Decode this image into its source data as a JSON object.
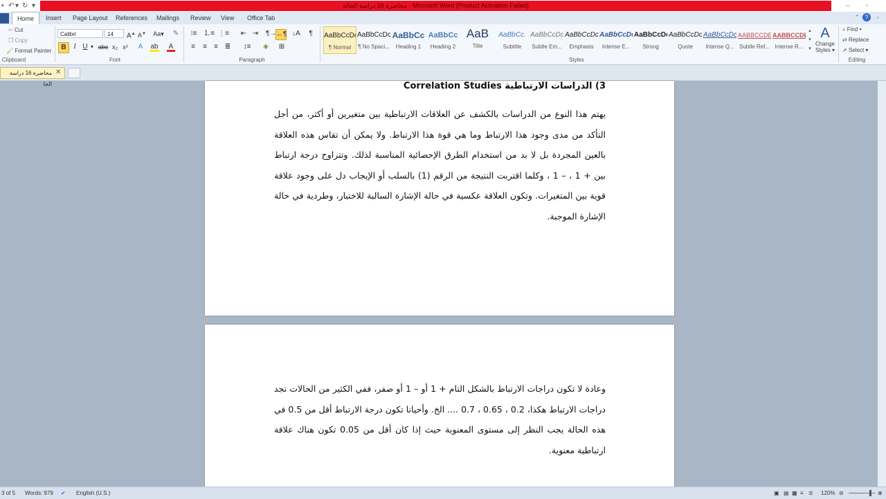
{
  "window": {
    "title": "محاضرة 16 دراسة الحالة  -  Microsoft Word (Product Activation Failed)",
    "controls": [
      "minimize",
      "restore",
      "close"
    ]
  },
  "ribbon_tabs": [
    {
      "label": "Home",
      "active": true
    },
    {
      "label": "Insert",
      "active": false
    },
    {
      "label": "Page Layout",
      "active": false
    },
    {
      "label": "References",
      "active": false
    },
    {
      "label": "Mailings",
      "active": false
    },
    {
      "label": "Review",
      "active": false
    },
    {
      "label": "View",
      "active": false
    },
    {
      "label": "Office Tab",
      "active": false
    }
  ],
  "clipboard": {
    "cut": "Cut",
    "copy": "Copy",
    "format_painter": "Format Painter",
    "label": "Clipboard"
  },
  "font": {
    "name": "Calibri",
    "size": "14",
    "label": "Font",
    "bold": "B",
    "italic": "I",
    "underline": "U",
    "strike": "abc"
  },
  "paragraph": {
    "label": "Paragraph"
  },
  "styles": {
    "label": "Styles",
    "items": [
      {
        "sample": "AaBbCcDc",
        "name": "¶ Normal"
      },
      {
        "sample": "AaBbCcDc",
        "name": "¶ No Spaci..."
      },
      {
        "sample": "AaBbCc",
        "name": "Heading 1"
      },
      {
        "sample": "AaBbCc",
        "name": "Heading 2"
      },
      {
        "sample": "AaB",
        "name": "Title"
      },
      {
        "sample": "AaBbCc.",
        "name": "Subtitle"
      },
      {
        "sample": "AaBbCcDc",
        "name": "Subtle Em..."
      },
      {
        "sample": "AaBbCcDc",
        "name": "Emphasis"
      },
      {
        "sample": "AaBbCcDc",
        "name": "Intense E..."
      },
      {
        "sample": "AaBbCcDc",
        "name": "Strong"
      },
      {
        "sample": "AaBbCcDc",
        "name": "Quote"
      },
      {
        "sample": "AaBbCcDc",
        "name": "Intense Q..."
      },
      {
        "sample": "AABBCCDE",
        "name": "Subtle Ref..."
      },
      {
        "sample": "AABBCCDE",
        "name": "Intense R..."
      }
    ],
    "change_styles_line1": "Change",
    "change_styles_line2": "Styles ▾"
  },
  "editing": {
    "label": "Editing",
    "find": "Find ▾",
    "replace": "Replace",
    "select": "Select ▾"
  },
  "doc_tab": {
    "label": "محاضرة 16 دراسة الحا"
  },
  "document": {
    "heading": "3) الدراسات الارتباطية Correlation Studies",
    "para1": "يهتم هذا النوع من الدراسات بالكشف عن العلاقات الارتباطية بين متغيرين أو أكثر، من أجل التأكد من مدى وجود هذا الارتباط وما هي قوة هذا الارتباط. ولا يمكن أن تقاس هذه العلاقة بالعين المجردة بل لا بد من استخدام الطرق الإحصائية المناسبة لذلك. وتتراوح درجة ارتباط بين + 1 ، – 1 ، وكلما اقتربت النتيجة من الرقم (1) بالسلب أو الإيجاب دل على وجود علاقة قوية بين المتغيرات. وتكون العلاقة عكسية في حالة الإشارة السالبة للاختبار، وطردية في حالة الإشارة الموجبة.",
    "para2": "وعادة لا تكون دراجات الارتباط بالشكل التام + 1 أو – 1 أو صفر، ففي الكثير من الحالات نجد دراجات الارتباط هكذا، 0.2 ، 0.65 ، 0.7 .... الخ. وأحيانا تكون درجة الارتباط أقل من 0.5 في هذه الحالة يجب النظر إلى مستوى المعنوية حيث إذا كان أقل من 0.05 تكون هناك علاقة ارتباطية معنوية."
  },
  "status": {
    "page": "3 of 5",
    "words": "Words: 979",
    "language": "English (U.S.)",
    "zoom": "120%"
  },
  "colors": {
    "title_bar_error": "#e81123",
    "ribbon_bg": "#f4f7fb",
    "workspace": "#a9b6c6",
    "doc_tab": "#fff3c4"
  }
}
